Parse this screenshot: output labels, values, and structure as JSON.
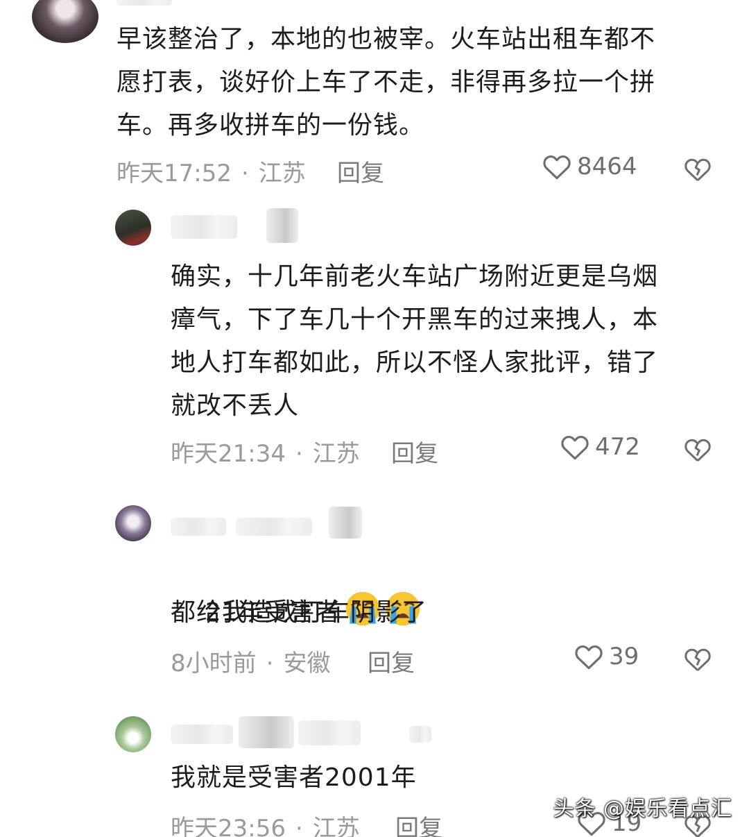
{
  "comments": [
    {
      "text": "早该整治了，本地的也被宰。火车站出租车都不\n愿打表，谈好价上车了不走，非得再多拉一个拼\n车。再多收拼车的一份钱。",
      "time": "昨天17:52",
      "dot": "·",
      "region": "江苏",
      "reply": "回复",
      "likes": "8464"
    },
    {
      "text": "确实，十几年前老火车站广场附近更是乌烟\n瘴气，下了车几十个开黑车的过来拽人，本\n地人打车都如此，所以不怪人家批评，错了\n就改不丢人",
      "time": "昨天21:34",
      "dot": "·",
      "region": "江苏",
      "reply": "回复",
      "likes": "472"
    },
    {
      "text_line1": "21年受害者",
      "text_line2": "都给我造成打车阴影了",
      "emoji": "loudly-crying-face",
      "time": "8小时前",
      "dot": "·",
      "region": "安徽",
      "reply": "回复",
      "likes": "39"
    },
    {
      "text": "我就是受害者2001年",
      "time": "昨天23:56",
      "dot": "·",
      "region": "江苏",
      "reply": "回复",
      "likes": "19"
    }
  ],
  "watermark": "头条 @娱乐看点汇",
  "colors": {
    "text": "#1c1c1c",
    "meta": "#9a9a9a",
    "icon": "#6e6e6e",
    "emoji": "#f7c531",
    "tears": "#3aa4e8"
  }
}
